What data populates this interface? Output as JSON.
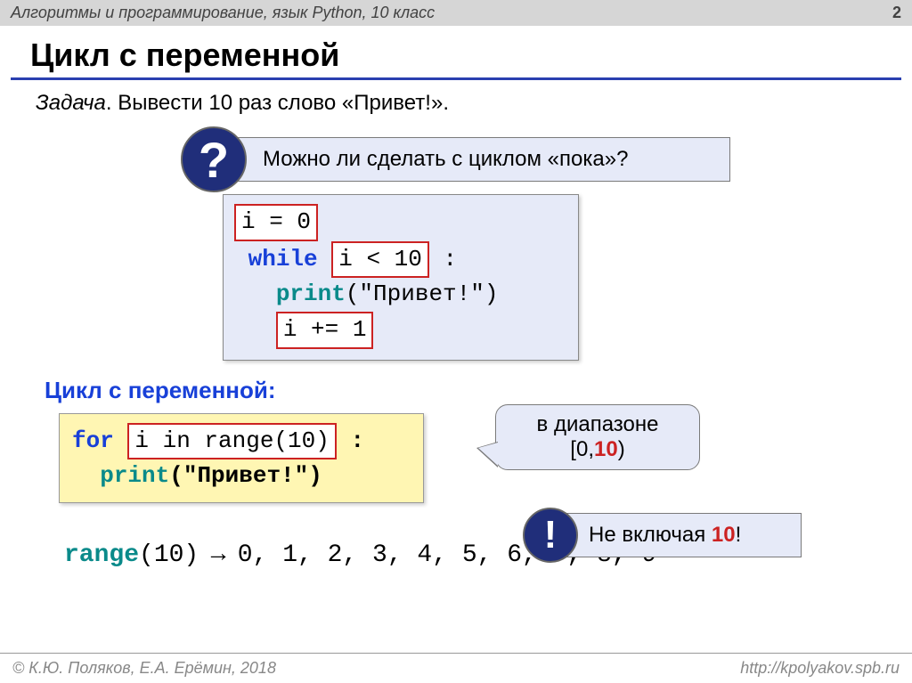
{
  "header": {
    "subject": "Алгоритмы и программирование, язык Python, 10 класс",
    "page": "2"
  },
  "title": "Цикл с переменной",
  "task": {
    "label": "Задача",
    "text": ". Вывести 10 раз слово «Привет!»."
  },
  "question": {
    "mark": "?",
    "text": "Можно ли сделать с циклом «пока»?"
  },
  "code1": {
    "l1": "i = 0",
    "while": "while",
    "cond": "i < 10",
    "colon": ":",
    "print": "print",
    "arg": "(\"Привет!\")",
    "inc": "i += 1"
  },
  "subhead": "Цикл с переменной:",
  "code2": {
    "for": "for",
    "body": "i in range(10)",
    "colon": ":",
    "print": "print",
    "arg": "(\"Привет!\")"
  },
  "callout_range": {
    "line1": "в диапазоне",
    "line2a": "[0,",
    "line2b": "10",
    "line2c": ")"
  },
  "exclaim": {
    "mark": "!",
    "text_a": "Не включая ",
    "text_b": "10",
    "text_c": "!"
  },
  "range_line": {
    "fn": "range",
    "arg": "(10)",
    "arrow": " → ",
    "seq": "0, 1, 2, 3, 4, 5, 6, 7, 8, 9"
  },
  "footer": {
    "left": "© К.Ю. Поляков, Е.А. Ерёмин, 2018",
    "right": "http://kpolyakov.spb.ru"
  }
}
